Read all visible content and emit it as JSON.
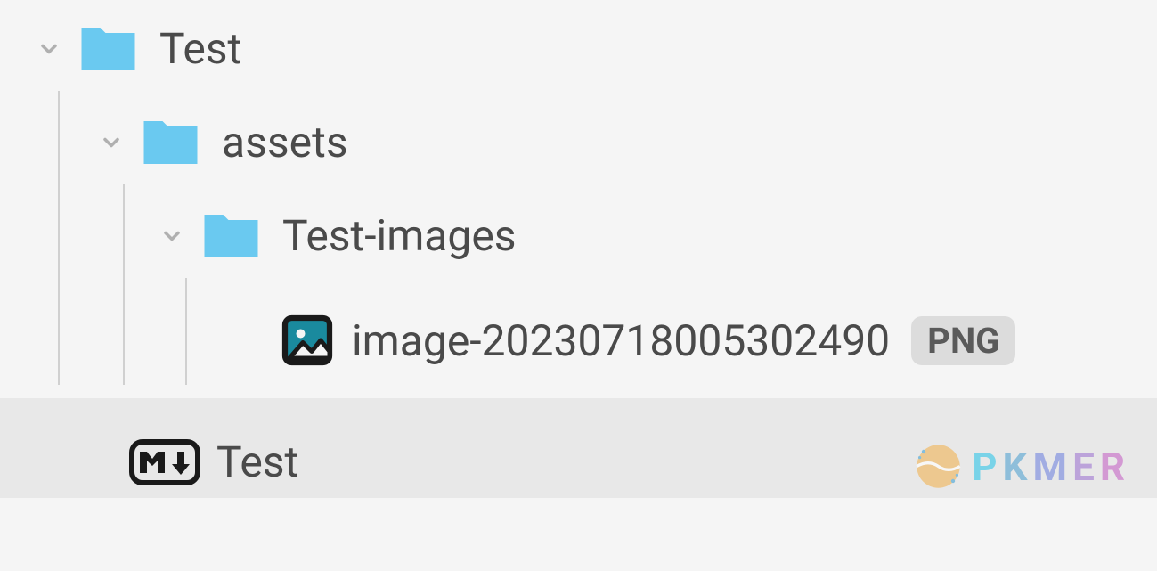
{
  "tree": {
    "root": {
      "label": "Test",
      "children": {
        "assets": {
          "label": "assets",
          "children": {
            "test_images": {
              "label": "Test-images",
              "children": {
                "image_file": {
                  "label": "image-20230718005302490",
                  "badge": "PNG"
                }
              }
            }
          }
        }
      }
    },
    "selected_file": {
      "label": "Test"
    }
  },
  "watermark": {
    "text": "PKMER"
  }
}
